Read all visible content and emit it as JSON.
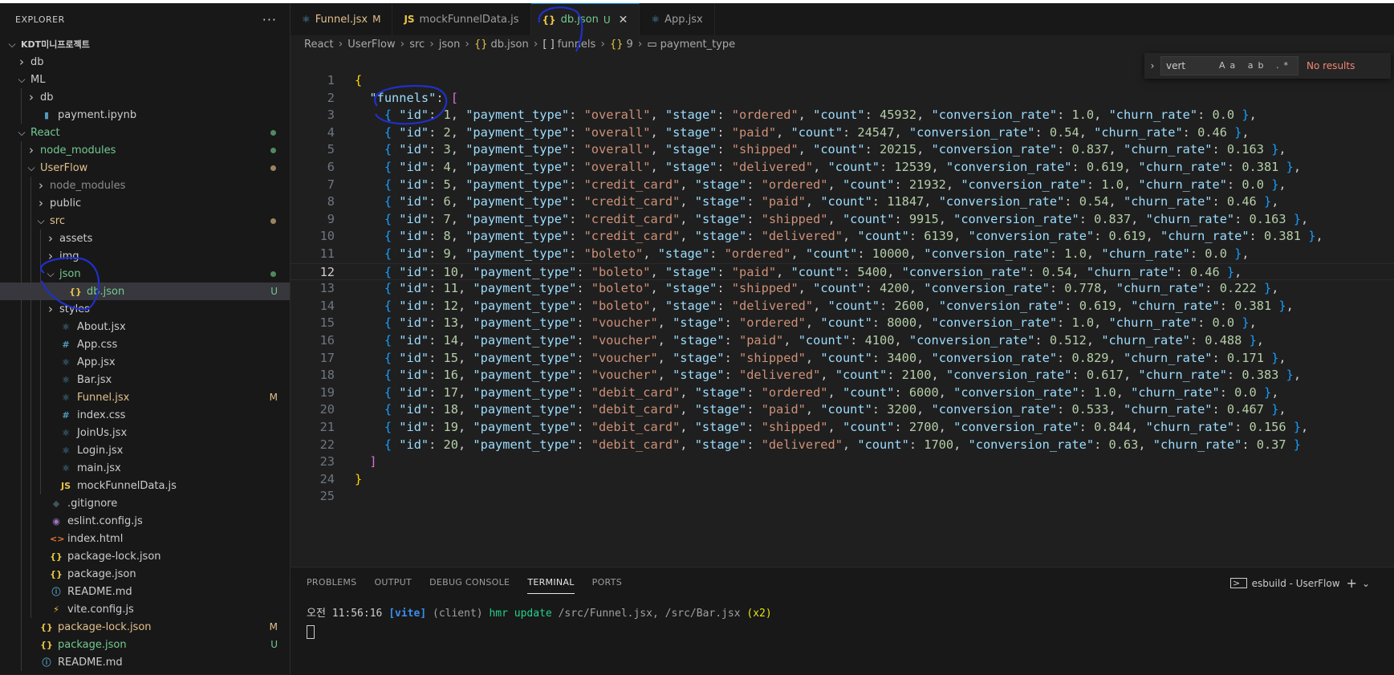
{
  "explorer": {
    "title": "EXPLORER",
    "more": "···",
    "tree": [
      {
        "label": "KDT미니프로젝트",
        "indent": 0,
        "chev": "open",
        "icon": "",
        "color": "#cccccc",
        "bold": true
      },
      {
        "label": "db",
        "indent": 1,
        "chev": "closed",
        "icon": "",
        "color": "#cccccc"
      },
      {
        "label": "ML",
        "indent": 1,
        "chev": "open",
        "icon": "",
        "color": "#cccccc"
      },
      {
        "label": "db",
        "indent": 2,
        "chev": "closed",
        "icon": "",
        "color": "#cccccc"
      },
      {
        "label": "payment.ipynb",
        "indent": 2,
        "chev": "",
        "icon": "▮",
        "iconColor": "#519aba",
        "color": "#cccccc"
      },
      {
        "label": "React",
        "indent": 1,
        "chev": "open",
        "icon": "",
        "color": "#73c991",
        "dot": "#4f8a5e"
      },
      {
        "label": "node_modules",
        "indent": 2,
        "chev": "closed",
        "icon": "",
        "color": "#73c991",
        "dot": "#4f8a5e"
      },
      {
        "label": "UserFlow",
        "indent": 2,
        "chev": "open",
        "icon": "",
        "color": "#e2c08d",
        "dot": "#9a8460"
      },
      {
        "label": "node_modules",
        "indent": 3,
        "chev": "closed",
        "icon": "",
        "color": "#8c8c8c"
      },
      {
        "label": "public",
        "indent": 3,
        "chev": "closed",
        "icon": "",
        "color": "#cccccc"
      },
      {
        "label": "src",
        "indent": 3,
        "chev": "open",
        "icon": "",
        "color": "#e2c08d",
        "dot": "#9a8460"
      },
      {
        "label": "assets",
        "indent": 4,
        "chev": "closed",
        "icon": "",
        "color": "#cccccc"
      },
      {
        "label": "img",
        "indent": 4,
        "chev": "closed",
        "icon": "",
        "color": "#cccccc"
      },
      {
        "label": "json",
        "indent": 4,
        "chev": "open",
        "icon": "",
        "color": "#73c991",
        "dot": "#4f8a5e"
      },
      {
        "label": "db.json",
        "indent": 5,
        "chev": "",
        "icon": "{}",
        "iconColor": "#e8c547",
        "color": "#73c991",
        "badge": "U",
        "badgeColor": "#73c991",
        "selected": true
      },
      {
        "label": "styles",
        "indent": 4,
        "chev": "closed",
        "icon": "",
        "color": "#cccccc"
      },
      {
        "label": "About.jsx",
        "indent": 4,
        "chev": "",
        "icon": "⚛",
        "iconColor": "#519aba",
        "color": "#cccccc"
      },
      {
        "label": "App.css",
        "indent": 4,
        "chev": "",
        "icon": "#",
        "iconColor": "#519aba",
        "color": "#cccccc"
      },
      {
        "label": "App.jsx",
        "indent": 4,
        "chev": "",
        "icon": "⚛",
        "iconColor": "#519aba",
        "color": "#cccccc"
      },
      {
        "label": "Bar.jsx",
        "indent": 4,
        "chev": "",
        "icon": "⚛",
        "iconColor": "#519aba",
        "color": "#cccccc"
      },
      {
        "label": "Funnel.jsx",
        "indent": 4,
        "chev": "",
        "icon": "⚛",
        "iconColor": "#519aba",
        "color": "#e2c08d",
        "badge": "M",
        "badgeColor": "#e2c08d"
      },
      {
        "label": "index.css",
        "indent": 4,
        "chev": "",
        "icon": "#",
        "iconColor": "#519aba",
        "color": "#cccccc"
      },
      {
        "label": "JoinUs.jsx",
        "indent": 4,
        "chev": "",
        "icon": "⚛",
        "iconColor": "#519aba",
        "color": "#cccccc"
      },
      {
        "label": "Login.jsx",
        "indent": 4,
        "chev": "",
        "icon": "⚛",
        "iconColor": "#519aba",
        "color": "#cccccc"
      },
      {
        "label": "main.jsx",
        "indent": 4,
        "chev": "",
        "icon": "⚛",
        "iconColor": "#519aba",
        "color": "#cccccc"
      },
      {
        "label": "mockFunnelData.js",
        "indent": 4,
        "chev": "",
        "icon": "JS",
        "iconColor": "#e8c547",
        "color": "#cccccc"
      },
      {
        "label": ".gitignore",
        "indent": 3,
        "chev": "",
        "icon": "◆",
        "iconColor": "#41535b",
        "color": "#cccccc"
      },
      {
        "label": "eslint.config.js",
        "indent": 3,
        "chev": "",
        "icon": "◉",
        "iconColor": "#a074c4",
        "color": "#cccccc"
      },
      {
        "label": "index.html",
        "indent": 3,
        "chev": "",
        "icon": "<>",
        "iconColor": "#e37933",
        "color": "#cccccc"
      },
      {
        "label": "package-lock.json",
        "indent": 3,
        "chev": "",
        "icon": "{}",
        "iconColor": "#e8c547",
        "color": "#cccccc"
      },
      {
        "label": "package.json",
        "indent": 3,
        "chev": "",
        "icon": "{}",
        "iconColor": "#e8c547",
        "color": "#cccccc"
      },
      {
        "label": "README.md",
        "indent": 3,
        "chev": "",
        "icon": "ⓘ",
        "iconColor": "#519aba",
        "color": "#cccccc"
      },
      {
        "label": "vite.config.js",
        "indent": 3,
        "chev": "",
        "icon": "⚡",
        "iconColor": "#e8c547",
        "color": "#cccccc"
      },
      {
        "label": "package-lock.json",
        "indent": 2,
        "chev": "",
        "icon": "{}",
        "iconColor": "#e8c547",
        "color": "#e2c08d",
        "badge": "M",
        "badgeColor": "#e2c08d"
      },
      {
        "label": "package.json",
        "indent": 2,
        "chev": "",
        "icon": "{}",
        "iconColor": "#e8c547",
        "color": "#73c991",
        "badge": "U",
        "badgeColor": "#73c991"
      },
      {
        "label": "README.md",
        "indent": 2,
        "chev": "",
        "icon": "ⓘ",
        "iconColor": "#519aba",
        "color": "#cccccc"
      }
    ]
  },
  "tabs": [
    {
      "icon": "⚛",
      "iconColor": "#519aba",
      "label": "Funnel.jsx",
      "mod": "M",
      "modColor": "#e2c08d",
      "labelColor": "#e2c08d",
      "active": false
    },
    {
      "icon": "JS",
      "iconColor": "#e8c547",
      "label": "mockFunnelData.js",
      "mod": "",
      "labelColor": "#9d9d9d",
      "active": false
    },
    {
      "icon": "{}",
      "iconColor": "#e8c547",
      "label": "db.json",
      "mod": "U",
      "modColor": "#73c991",
      "labelColor": "#73c991",
      "active": true,
      "close": "✕"
    },
    {
      "icon": "⚛",
      "iconColor": "#519aba",
      "label": "App.jsx",
      "mod": "",
      "labelColor": "#9d9d9d",
      "active": false
    }
  ],
  "breadcrumb": [
    {
      "icon": "",
      "label": "React"
    },
    {
      "icon": "",
      "label": "UserFlow"
    },
    {
      "icon": "",
      "label": "src"
    },
    {
      "icon": "",
      "label": "json"
    },
    {
      "icon": "{}",
      "label": "db.json"
    },
    {
      "icon": "[ ]",
      "label": "funnels"
    },
    {
      "icon": "{}",
      "label": "9"
    },
    {
      "icon": "▭",
      "label": "payment_type"
    }
  ],
  "find": {
    "value": "vert",
    "options": "Aa ab .*",
    "result": "No results"
  },
  "editor": {
    "current_line": 12,
    "funnels_key": "funnels",
    "rows": [
      {
        "id": 1,
        "payment_type": "overall",
        "stage": "ordered",
        "count": 45932,
        "conversion_rate": "1.0",
        "churn_rate": "0.0"
      },
      {
        "id": 2,
        "payment_type": "overall",
        "stage": "paid",
        "count": 24547,
        "conversion_rate": "0.54",
        "churn_rate": "0.46"
      },
      {
        "id": 3,
        "payment_type": "overall",
        "stage": "shipped",
        "count": 20215,
        "conversion_rate": "0.837",
        "churn_rate": "0.163"
      },
      {
        "id": 4,
        "payment_type": "overall",
        "stage": "delivered",
        "count": 12539,
        "conversion_rate": "0.619",
        "churn_rate": "0.381"
      },
      {
        "id": 5,
        "payment_type": "credit_card",
        "stage": "ordered",
        "count": 21932,
        "conversion_rate": "1.0",
        "churn_rate": "0.0"
      },
      {
        "id": 6,
        "payment_type": "credit_card",
        "stage": "paid",
        "count": 11847,
        "conversion_rate": "0.54",
        "churn_rate": "0.46"
      },
      {
        "id": 7,
        "payment_type": "credit_card",
        "stage": "shipped",
        "count": 9915,
        "conversion_rate": "0.837",
        "churn_rate": "0.163"
      },
      {
        "id": 8,
        "payment_type": "credit_card",
        "stage": "delivered",
        "count": 6139,
        "conversion_rate": "0.619",
        "churn_rate": "0.381"
      },
      {
        "id": 9,
        "payment_type": "boleto",
        "stage": "ordered",
        "count": 10000,
        "conversion_rate": "1.0",
        "churn_rate": "0.0"
      },
      {
        "id": 10,
        "payment_type": "boleto",
        "stage": "paid",
        "count": 5400,
        "conversion_rate": "0.54",
        "churn_rate": "0.46"
      },
      {
        "id": 11,
        "payment_type": "boleto",
        "stage": "shipped",
        "count": 4200,
        "conversion_rate": "0.778",
        "churn_rate": "0.222"
      },
      {
        "id": 12,
        "payment_type": "boleto",
        "stage": "delivered",
        "count": 2600,
        "conversion_rate": "0.619",
        "churn_rate": "0.381"
      },
      {
        "id": 13,
        "payment_type": "voucher",
        "stage": "ordered",
        "count": 8000,
        "conversion_rate": "1.0",
        "churn_rate": "0.0"
      },
      {
        "id": 14,
        "payment_type": "voucher",
        "stage": "paid",
        "count": 4100,
        "conversion_rate": "0.512",
        "churn_rate": "0.488"
      },
      {
        "id": 15,
        "payment_type": "voucher",
        "stage": "shipped",
        "count": 3400,
        "conversion_rate": "0.829",
        "churn_rate": "0.171"
      },
      {
        "id": 16,
        "payment_type": "voucher",
        "stage": "delivered",
        "count": 2100,
        "conversion_rate": "0.617",
        "churn_rate": "0.383"
      },
      {
        "id": 17,
        "payment_type": "debit_card",
        "stage": "ordered",
        "count": 6000,
        "conversion_rate": "1.0",
        "churn_rate": "0.0"
      },
      {
        "id": 18,
        "payment_type": "debit_card",
        "stage": "paid",
        "count": 3200,
        "conversion_rate": "0.533",
        "churn_rate": "0.467"
      },
      {
        "id": 19,
        "payment_type": "debit_card",
        "stage": "shipped",
        "count": 2700,
        "conversion_rate": "0.844",
        "churn_rate": "0.156"
      },
      {
        "id": 20,
        "payment_type": "debit_card",
        "stage": "delivered",
        "count": 1700,
        "conversion_rate": "0.63",
        "churn_rate": "0.37"
      }
    ]
  },
  "panel": {
    "tabs": [
      "PROBLEMS",
      "OUTPUT",
      "DEBUG CONSOLE",
      "TERMINAL",
      "PORTS"
    ],
    "active_tab": "TERMINAL",
    "terminal_name": "esbuild - UserFlow",
    "plus": "+",
    "chevron": "⌄",
    "log": {
      "time": "오전 11:56:16",
      "tag": "[vite]",
      "source": "(client)",
      "action": "hmr update",
      "files": "/src/Funnel.jsx, /src/Bar.jsx",
      "repeat": "(x2)"
    }
  }
}
